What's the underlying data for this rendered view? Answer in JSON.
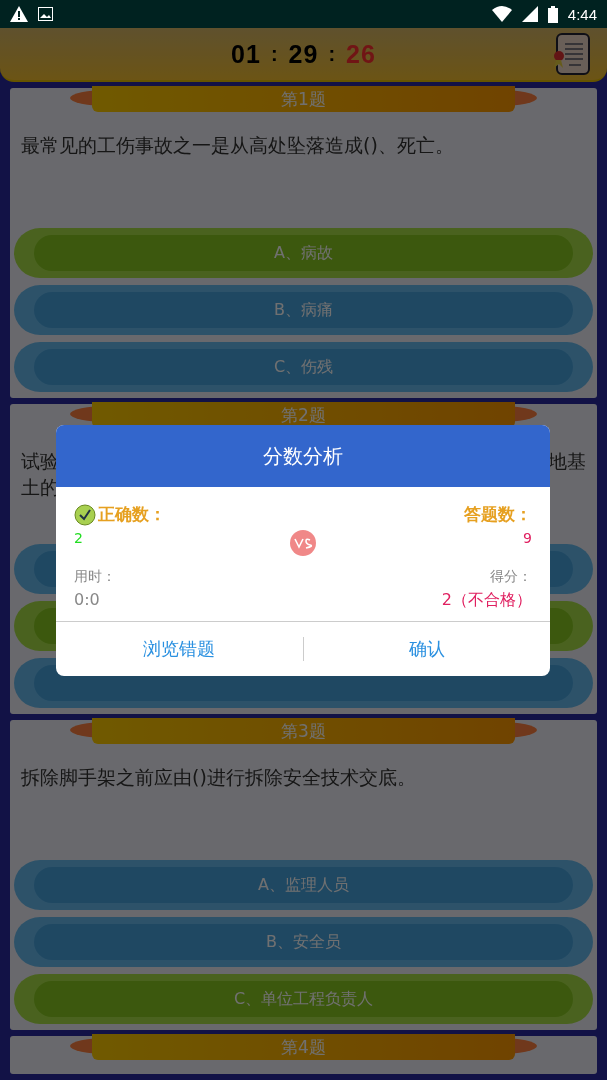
{
  "status_bar": {
    "time": "4:44"
  },
  "timer": [
    {
      "text": "01",
      "kind": "digits"
    },
    {
      "text": ":",
      "kind": "sep"
    },
    {
      "text": "29",
      "kind": "digits"
    },
    {
      "text": ":",
      "kind": "sep"
    },
    {
      "text": "26",
      "kind": "alert"
    }
  ],
  "questions": [
    {
      "title": "第1题",
      "text": "最常见的工伤事故之一是从高处坠落造成()、死亡。",
      "options": [
        {
          "label": "A、病故",
          "correct": true
        },
        {
          "label": "B、病痛",
          "correct": false
        },
        {
          "label": "C、伤残",
          "correct": false
        }
      ]
    },
    {
      "title": "第2题",
      "text_lines": [
        {
          "left": "试验",
          "right": "地基"
        },
        {
          "left": "土的"
        }
      ],
      "options": [
        {
          "correct": false
        },
        {
          "correct": true
        },
        {
          "correct": false
        }
      ]
    },
    {
      "title": "第3题",
      "text": "拆除脚手架之前应由()进行拆除安全技术交底。",
      "options": [
        {
          "label": "A、监理人员",
          "correct": false
        },
        {
          "label": "B、安全员",
          "correct": false
        },
        {
          "label": "C、单位工程负责人",
          "correct": true
        }
      ]
    },
    {
      "title": "第4题"
    }
  ],
  "dialog": {
    "title": "分数分析",
    "correct_label": "正确数：",
    "correct_value": "2",
    "total_label": "答题数：",
    "total_value": "9",
    "time_label": "用时：",
    "time_value": "0:0",
    "score_label": "得分：",
    "score_value": "2（不合格）",
    "buttons": [
      "浏览错题",
      "确认"
    ]
  }
}
